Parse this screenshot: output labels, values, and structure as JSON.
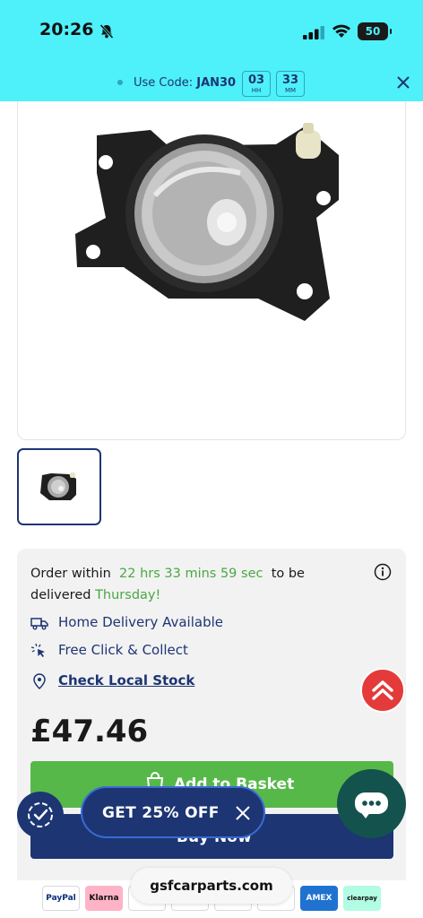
{
  "status_bar": {
    "time": "20:26",
    "battery": "50"
  },
  "promo": {
    "label": "Use Code:",
    "code": "JAN30",
    "hours": "03",
    "hours_unit": "HH",
    "minutes": "33",
    "minutes_unit": "MM"
  },
  "delivery": {
    "order_prefix": "Order within",
    "countdown": "22 hrs 33 mins 59 sec",
    "order_mid": "to be delivered",
    "day": "Thursday!",
    "home_delivery": "Home Delivery Available",
    "click_collect": "Free Click & Collect",
    "check_stock": "Check Local Stock"
  },
  "product": {
    "price": "£47.46",
    "add_to_basket": "Add to Basket",
    "buy_now": "Buy Now"
  },
  "floating": {
    "discount_label": "GET 25% OFF"
  },
  "browser": {
    "domain": "gsfcarparts.com"
  },
  "payments": {
    "paypal": "PayPal",
    "klarna": "Klarna",
    "amex": "AMEX",
    "clearpay": "clearpay"
  },
  "colors": {
    "promo_bg": "#4ef0fa",
    "navy": "#1d3573",
    "green": "#57b84a",
    "red": "#e43a3a",
    "chat": "#14524d"
  }
}
